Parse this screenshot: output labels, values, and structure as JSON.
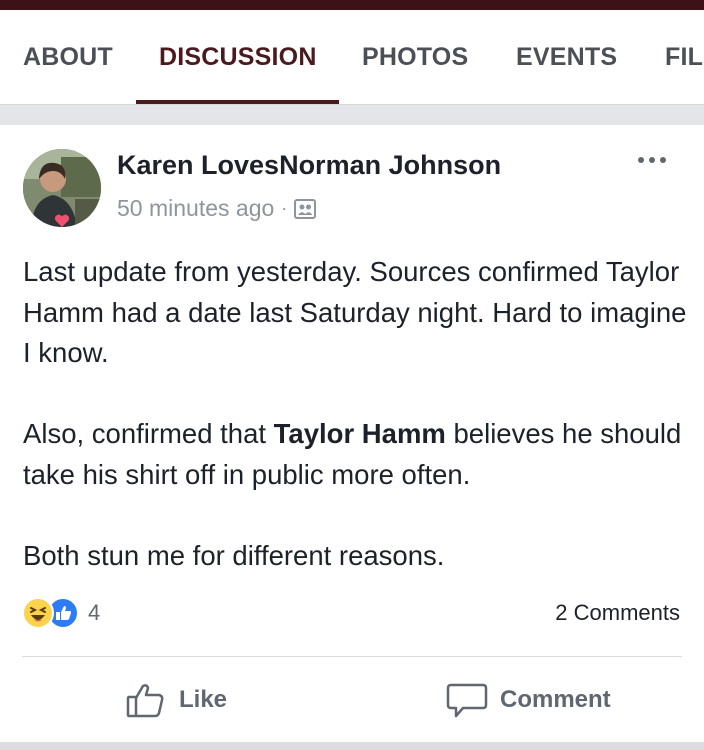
{
  "tabs": [
    {
      "label": "ABOUT"
    },
    {
      "label": "DISCUSSION"
    },
    {
      "label": "PHOTOS"
    },
    {
      "label": "EVENTS"
    },
    {
      "label": "FIL"
    }
  ],
  "active_tab": "DISCUSSION",
  "post": {
    "author": "Karen LovesNorman Johnson",
    "timestamp": "50 minutes ago",
    "separator": "·",
    "privacy_icon": "group-icon",
    "body": {
      "p1": "Last update from yesterday.  Sources confirmed Taylor Hamm had a date last Saturday night.  Hard to imagine I know.",
      "p2_before": "Also, confirmed that ",
      "p2_bold": "Taylor Hamm",
      "p2_after": " believes he should take his shirt off in public more often.",
      "p3": "Both stun me for different reasons."
    },
    "reactions": {
      "types": [
        "haha",
        "like"
      ],
      "count": "4"
    },
    "comments_count": "2 Comments"
  },
  "actions": {
    "like_label": "Like",
    "comment_label": "Comment"
  },
  "colors": {
    "brand_dark": "#4a1a1f",
    "text_primary": "#1d2129",
    "text_secondary": "#606770",
    "like_blue": "#2d7cf6",
    "haha_yellow": "#fcd34d"
  }
}
